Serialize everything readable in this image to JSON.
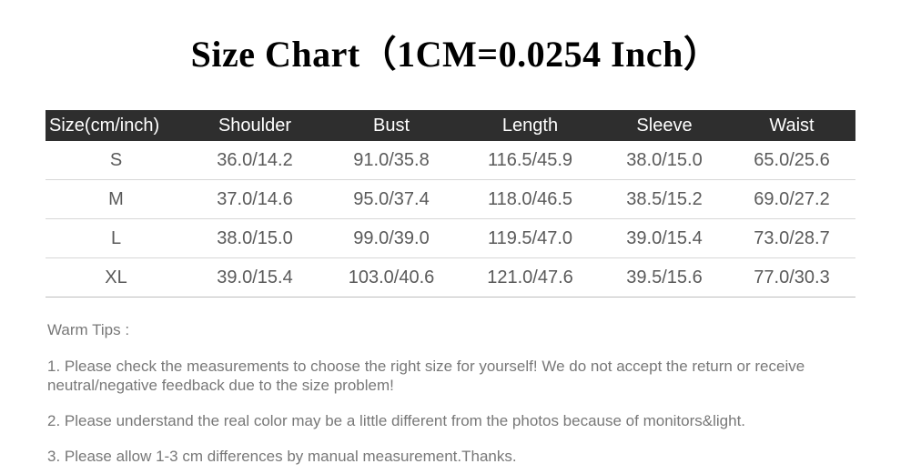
{
  "title": "Size Chart（1CM=0.0254 Inch）",
  "colors": {
    "header_bg": "#2e2e2e",
    "header_text": "#ffffff",
    "cell_text": "#5a5a5a",
    "tips_text": "#787878",
    "rule": "#d7d7d7",
    "title_text": "#000000",
    "page_bg": "#ffffff"
  },
  "table": {
    "columns": [
      "Size(cm/inch)",
      "Shoulder",
      "Bust",
      "Length",
      "Sleeve",
      "Waist"
    ],
    "rows": [
      {
        "size": "S",
        "shoulder": "36.0/14.2",
        "bust": "91.0/35.8",
        "length": "116.5/45.9",
        "sleeve": "38.0/15.0",
        "waist": "65.0/25.6"
      },
      {
        "size": "M",
        "shoulder": "37.0/14.6",
        "bust": "95.0/37.4",
        "length": "118.0/46.5",
        "sleeve": "38.5/15.2",
        "waist": "69.0/27.2"
      },
      {
        "size": "L",
        "shoulder": "38.0/15.0",
        "bust": "99.0/39.0",
        "length": "119.5/47.0",
        "sleeve": "39.0/15.4",
        "waist": "73.0/28.7"
      },
      {
        "size": "XL",
        "shoulder": "39.0/15.4",
        "bust": "103.0/40.6",
        "length": "121.0/47.6",
        "sleeve": "39.5/15.6",
        "waist": "77.0/30.3"
      }
    ]
  },
  "tips": {
    "heading": "Warm Tips :",
    "items": [
      "1. Please check the measurements to choose the right size for yourself! We do not accept the return or receive neutral/negative feedback due to the size problem!",
      "2. Please understand the real color may be a little different from the photos because of monitors&light.",
      "3. Please allow 1-3 cm differences by manual measurement.Thanks."
    ]
  }
}
